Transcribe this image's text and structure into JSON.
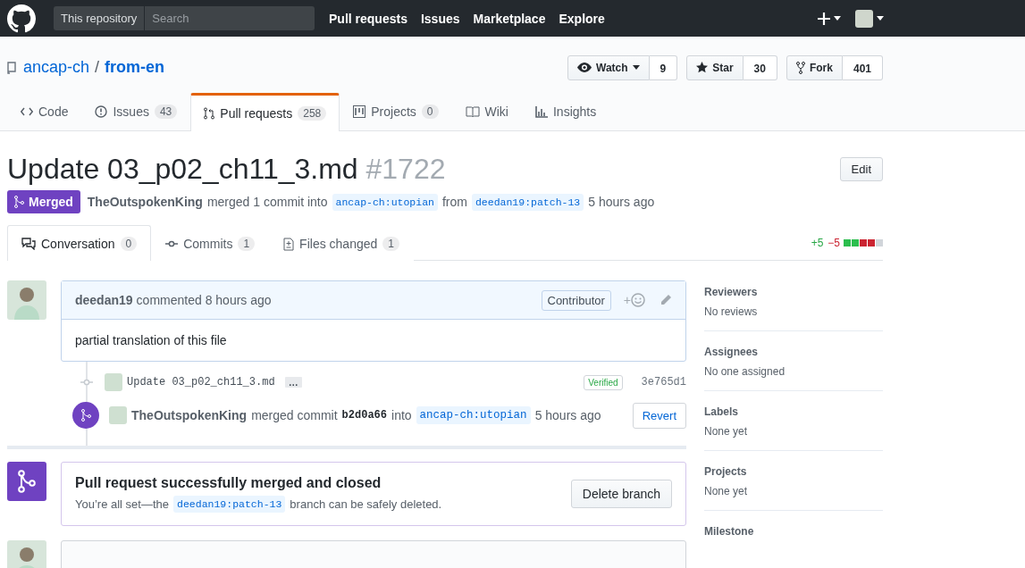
{
  "header": {
    "scope": "This repository",
    "search": {
      "placeholder": "Search"
    },
    "nav": [
      "Pull requests",
      "Issues",
      "Marketplace",
      "Explore"
    ]
  },
  "repo": {
    "owner": "ancap-ch",
    "separator": "/",
    "name": "from-en",
    "actions": [
      {
        "label": "Watch",
        "count": "9",
        "dropdown": true
      },
      {
        "label": "Star",
        "count": "30",
        "dropdown": false
      },
      {
        "label": "Fork",
        "count": "401",
        "dropdown": false
      }
    ]
  },
  "repo_tabs": [
    {
      "label": "Code",
      "selected": false
    },
    {
      "label": "Issues",
      "count": "43",
      "selected": false
    },
    {
      "label": "Pull requests",
      "count": "258",
      "selected": true
    },
    {
      "label": "Projects",
      "count": "0",
      "selected": false
    },
    {
      "label": "Wiki",
      "selected": false
    },
    {
      "label": "Insights",
      "selected": false
    }
  ],
  "pr": {
    "title": "Update 03_p02_ch11_3.md",
    "number": "#1722",
    "state": "Merged",
    "author": "TheOutspokenKing",
    "action": "merged 1 commit into",
    "base": "ancap-ch:utopian",
    "from": "from",
    "head": "deedan19:patch-13",
    "time": "5 hours ago",
    "edit": "Edit"
  },
  "pr_tabs": [
    {
      "label": "Conversation",
      "count": "0",
      "selected": true
    },
    {
      "label": "Commits",
      "count": "1",
      "selected": false
    },
    {
      "label": "Files changed",
      "count": "1",
      "selected": false
    }
  ],
  "diffstat": {
    "added": "+5",
    "deleted": "−5",
    "blocks": [
      {
        "kind": "added"
      },
      {
        "kind": "added"
      },
      {
        "kind": "deleted"
      },
      {
        "kind": "deleted"
      },
      {
        "kind": "neutral"
      }
    ]
  },
  "comment": {
    "author": "deedan19",
    "meta": "commented 8 hours ago",
    "badge": "Contributor",
    "reaction": "+",
    "body": "partial translation of this file"
  },
  "commit": {
    "message": "Update 03_p02_ch11_3.md",
    "more": "…",
    "verified": "Verified",
    "sha": "3e765d1"
  },
  "merge_event": {
    "author": "TheOutspokenKing",
    "action": "merged commit",
    "sha": "b2d0a66",
    "into": "into",
    "base": "ancap-ch:utopian",
    "time": "5 hours ago",
    "button": "Revert"
  },
  "merged_box": {
    "title": "Pull request successfully merged and closed",
    "before": "You’re all set—the",
    "branch": "deedan19:patch-13",
    "after": "branch can be safely deleted.",
    "button": "Delete branch"
  },
  "sidebar": [
    {
      "heading": "Reviewers",
      "value": "No reviews"
    },
    {
      "heading": "Assignees",
      "value": "No one assigned"
    },
    {
      "heading": "Labels",
      "value": "None yet"
    },
    {
      "heading": "Projects",
      "value": "None yet"
    },
    {
      "heading": "Milestone"
    }
  ]
}
